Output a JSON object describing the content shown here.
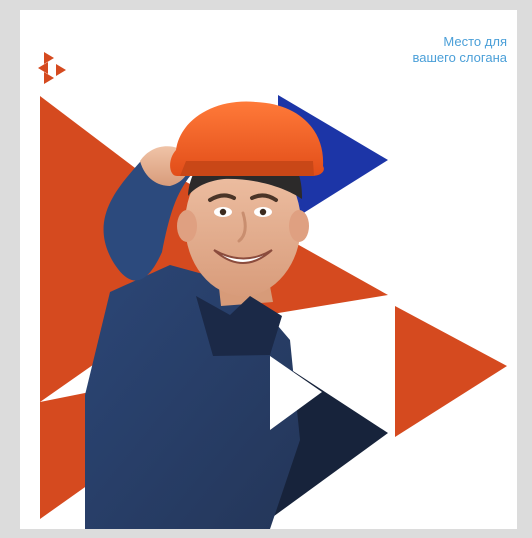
{
  "slogan": {
    "line1": "Место для",
    "line2": "вашего слогана"
  },
  "colors": {
    "orange": "#d54a1f",
    "blue": "#1c35a7",
    "dark_navy": "#17233b",
    "white": "#ffffff",
    "slogan_text": "#4a9fd8"
  },
  "photo": {
    "subject": "worker-in-orange-hard-hat"
  }
}
